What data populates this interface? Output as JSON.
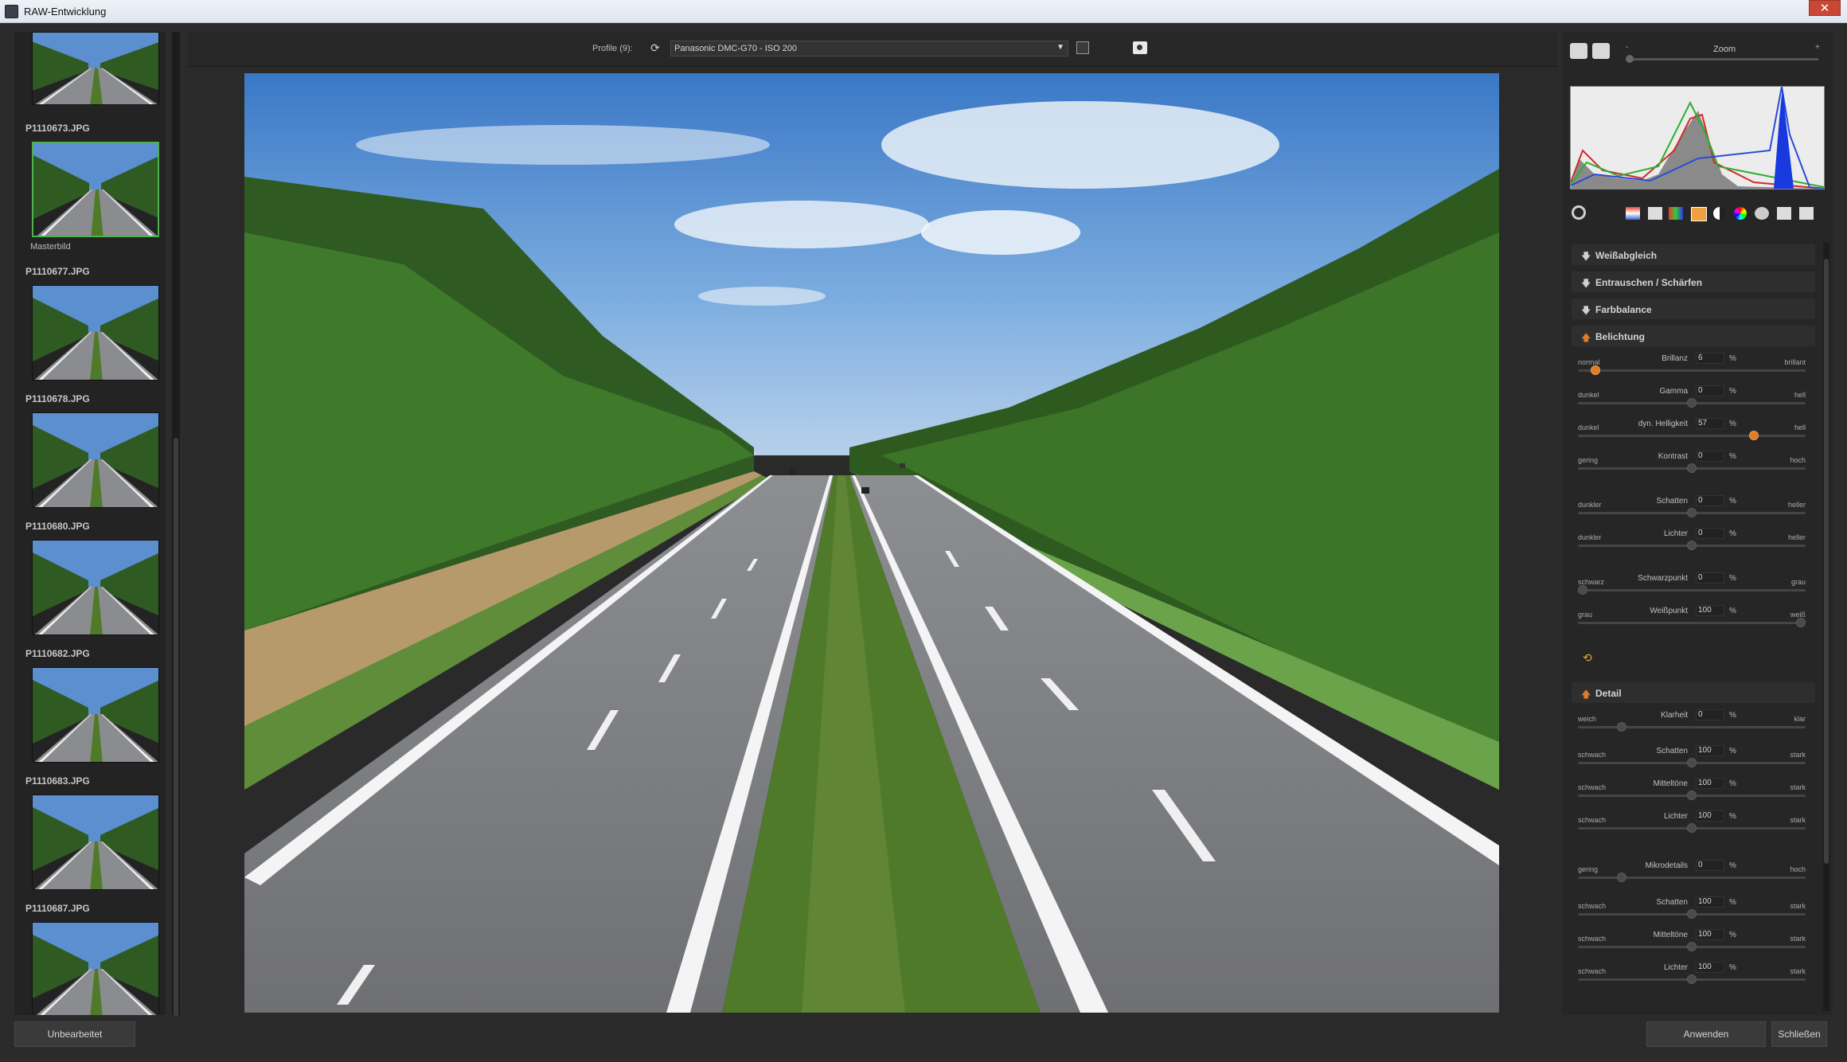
{
  "window": {
    "title": "RAW-Entwicklung",
    "close": "✕"
  },
  "filmstrip": {
    "items": [
      {
        "name": "",
        "master": ""
      },
      {
        "name": "P1110673.JPG",
        "master": "Masterbild",
        "selected": true
      },
      {
        "name": "P1110677.JPG"
      },
      {
        "name": "P1110678.JPG"
      },
      {
        "name": "P1110680.JPG"
      },
      {
        "name": "P1110682.JPG"
      },
      {
        "name": "P1110683.JPG"
      },
      {
        "name": "P1110687.JPG"
      }
    ]
  },
  "toolbar": {
    "profile_label": "Profile (9):",
    "profile_value": "Panasonic DMC-G70 - ISO 200"
  },
  "right": {
    "zoom_label": "Zoom",
    "zoom_minus": "-",
    "zoom_plus": "+",
    "sections": {
      "weissabgleich": "Weißabgleich",
      "entrauschen": "Entrauschen / Schärfen",
      "farbbalance": "Farbbalance",
      "belichtung": "Belichtung",
      "detail": "Detail"
    },
    "belichtung": [
      {
        "left": "normal",
        "name": "Brillanz",
        "value": "6",
        "unit": "%",
        "right": "brillant",
        "pos": 0.06,
        "accent": true
      },
      {
        "left": "dunkel",
        "name": "Gamma",
        "value": "0",
        "unit": "%",
        "right": "hell",
        "pos": 0.5
      },
      {
        "left": "dunkel",
        "name": "dyn. Helligkeit",
        "value": "57",
        "unit": "%",
        "right": "hell",
        "pos": 0.785,
        "accent": true
      },
      {
        "left": "gering",
        "name": "Kontrast",
        "value": "0",
        "unit": "%",
        "right": "hoch",
        "pos": 0.5
      },
      {
        "left": "dunkler",
        "name": "Schatten",
        "value": "0",
        "unit": "%",
        "right": "heller",
        "pos": 0.5
      },
      {
        "left": "dunkler",
        "name": "Lichter",
        "value": "0",
        "unit": "%",
        "right": "heller",
        "pos": 0.5
      },
      {
        "left": "schwarz",
        "name": "Schwarzpunkt",
        "value": "0",
        "unit": "%",
        "right": "grau",
        "pos": 0.0
      },
      {
        "left": "grau",
        "name": "Weißpunkt",
        "value": "100",
        "unit": "%",
        "right": "weiß",
        "pos": 1.0
      }
    ],
    "detail": [
      {
        "left": "weich",
        "name": "Klarheit",
        "value": "0",
        "unit": "%",
        "right": "klar",
        "pos": 0.18
      },
      {
        "left": "schwach",
        "name": "Schatten",
        "value": "100",
        "unit": "%",
        "right": "stark",
        "pos": 0.5
      },
      {
        "left": "schwach",
        "name": "Mitteltöne",
        "value": "100",
        "unit": "%",
        "right": "stark",
        "pos": 0.5
      },
      {
        "left": "schwach",
        "name": "Lichter",
        "value": "100",
        "unit": "%",
        "right": "stark",
        "pos": 0.5
      },
      {
        "left": "gering",
        "name": "Mikrodetails",
        "value": "0",
        "unit": "%",
        "right": "hoch",
        "pos": 0.18
      },
      {
        "left": "schwach",
        "name": "Schatten",
        "value": "100",
        "unit": "%",
        "right": "stark",
        "pos": 0.5
      },
      {
        "left": "schwach",
        "name": "Mitteltöne",
        "value": "100",
        "unit": "%",
        "right": "stark",
        "pos": 0.5
      },
      {
        "left": "schwach",
        "name": "Lichter",
        "value": "100",
        "unit": "%",
        "right": "stark",
        "pos": 0.5
      }
    ]
  },
  "bottom": {
    "unbearbeitet": "Unbearbeitet",
    "anwenden": "Anwenden",
    "schliessen": "Schließen"
  }
}
